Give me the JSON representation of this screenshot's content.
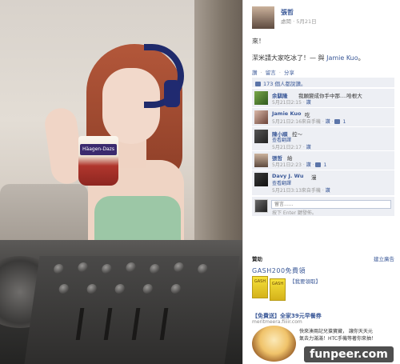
{
  "post": {
    "poster_name": "張哲",
    "privacy": "處聞",
    "date": "5月21日",
    "text_1": "來！",
    "text_2_before": "潔米請大家吃冰了！— 與",
    "tagged": "Jamie Kuo",
    "tagged_suffix": "。"
  },
  "actions": {
    "like": "讚",
    "comment": "留言",
    "share": "分享",
    "sep": "·"
  },
  "likes": {
    "text": "173 個人都說讚。"
  },
  "comments": [
    {
      "name": "余騏隆",
      "text": "我願變成你手中那....哈根大",
      "meta": "5月21日2:15",
      "like": "讚",
      "likes": ""
    },
    {
      "name": "Jamie Kuo",
      "text": "吃",
      "meta": "5月21日2:16來自手機",
      "like": "讚",
      "likes": "1"
    },
    {
      "name": "陳小順",
      "text": "控～",
      "meta": "5月21日2:17",
      "like": "讚",
      "likes": ""
    },
    {
      "name": "張哲",
      "text": "給",
      "meta": "5月21日2:23",
      "like": "讚",
      "likes": "1"
    },
    {
      "name": "Davy J. Wu",
      "text": "漫",
      "meta": "5月21日3:13來自手機",
      "like": "讚",
      "likes": ""
    }
  ],
  "see_translation": "查看翻譯",
  "comment_box": {
    "placeholder": "留言......",
    "hint": "按下 Enter 鍵發佈。"
  },
  "ads": {
    "header": "贊助",
    "create": "建立廣告",
    "ad1": {
      "title": "GASH200免費領",
      "cta": "【我要領取】",
      "box_label": "GASH"
    },
    "ad2": {
      "title": "【免費送】全家39元早餐券",
      "url": "meritmeera.fiiiir.com",
      "desc_1": "快來湊兩記兒搶寶藏， 讓你天天元",
      "desc_2": "氣去力滿滿！HTC手機等著你來抽！"
    }
  },
  "watermark": "funpeer.com",
  "colors": {
    "fb_link": "#3b5998",
    "comment_bg": "#edeff4",
    "mixer": "#2e2d2c"
  },
  "icons": [
    "thumbs-up-icon",
    "like-count-icon"
  ]
}
